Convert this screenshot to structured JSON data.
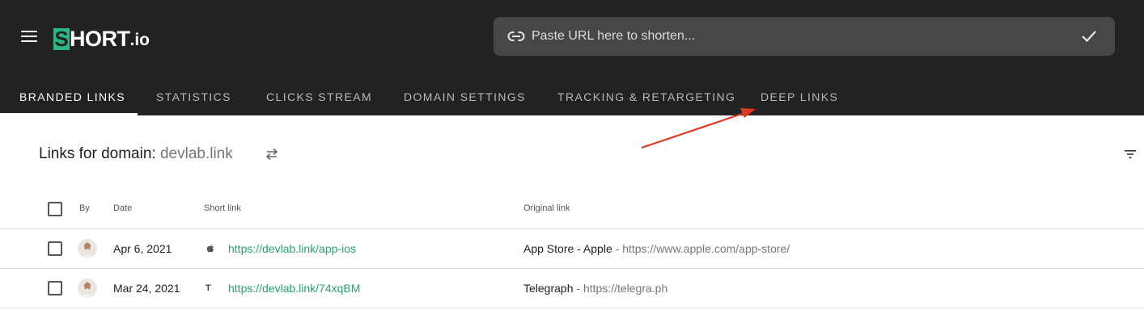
{
  "brand": {
    "logo_s": "S",
    "logo_text": "HORT",
    "logo_suffix": ".io"
  },
  "url_bar": {
    "placeholder": "Paste URL here to shorten...",
    "value": ""
  },
  "tabs": [
    {
      "label": "BRANDED LINKS",
      "active": true
    },
    {
      "label": "STATISTICS",
      "active": false
    },
    {
      "label": "CLICKS STREAM",
      "active": false
    },
    {
      "label": "DOMAIN SETTINGS",
      "active": false
    },
    {
      "label": "TRACKING & RETARGETING",
      "active": false
    },
    {
      "label": "DEEP LINKS",
      "active": false
    }
  ],
  "page": {
    "title_prefix": "Links for domain:",
    "domain": "devlab.link"
  },
  "table": {
    "columns": {
      "by": "By",
      "date": "Date",
      "short_link": "Short link",
      "original_link": "Original link"
    },
    "rows": [
      {
        "date": "Apr 6, 2021",
        "site_icon": "apple-icon",
        "short_link": "https://devlab.link/app-ios",
        "original_title": "App Store - Apple",
        "separator": " - ",
        "original_url": "https://www.apple.com/app-store/"
      },
      {
        "date": "Mar 24, 2021",
        "site_icon": "telegraph-icon",
        "site_glyph": "T",
        "short_link": "https://devlab.link/74xqBM",
        "original_title": "Telegraph",
        "separator": " - ",
        "original_url": "https://telegra.ph"
      }
    ]
  },
  "colors": {
    "header_bg": "#222222",
    "accent_green": "#2ab784",
    "link_green": "#25a56f",
    "annotation_arrow": "#e0391f"
  }
}
